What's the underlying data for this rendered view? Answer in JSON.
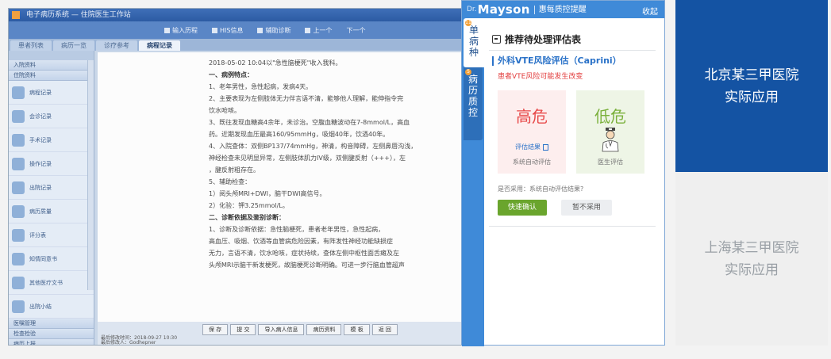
{
  "emr": {
    "title": "电子病历系统 — 住院医生工作站",
    "toolbar": [
      "输入历程",
      "HIS信息",
      "辅助诊断",
      "上一个",
      "下一个"
    ],
    "tabs": [
      "患者列表",
      "病历一览",
      "诊疗参考",
      "病程记录"
    ],
    "left_top_cats": [
      "入院资料",
      "住院资料"
    ],
    "left_items": [
      "病程记录",
      "会诊记录",
      "手术记录",
      "操作记录",
      "出院记录",
      "病历质量",
      "评分表",
      "知情同意书",
      "其他医疗文书",
      "出院小结"
    ],
    "left_bottom_cats": [
      "医嘱管理",
      "检查检验",
      "病历上报",
      "病历管理",
      "报表查询"
    ],
    "doc_lines": [
      {
        "t": "2018-05-02 10:04以\"急性脑梗死\"收入我科。",
        "b": false
      },
      {
        "t": "一、病例特点：",
        "b": true
      },
      {
        "t": "1、老年男性，急性起病，发病4天。",
        "b": false
      },
      {
        "t": "2、主要表现为左侧肢体无力伴言语不清，能够他人理解，能伸指令完",
        "b": false
      },
      {
        "t": "   饮水呛咳。",
        "b": false
      },
      {
        "t": "3、既往发现血糖高4余年，未诊治。空腹血糖波动在7-8mmol/L，高血",
        "b": false
      },
      {
        "t": "药。近期发现血压最高160/95mmHg，吸烟40年，饮酒40年。",
        "b": false
      },
      {
        "t": "4、入院查体：双侧BP137/74mmHg，神清，构音障碍，左侧鼻唇沟浅，",
        "b": false
      },
      {
        "t": "   神经检查未见明显异常，左侧肢体肌力IV级，双侧腱反射（+++），左",
        "b": false
      },
      {
        "t": "   ，腱反射粗存在。",
        "b": false
      },
      {
        "t": "5、辅助检查：",
        "b": false
      },
      {
        "t": "1）阅头颅MRI+DWI，脑干DWI高信号。",
        "b": false
      },
      {
        "t": "2）化验：钾3.25mmol/L。",
        "b": false
      },
      {
        "t": "二、诊断依据及鉴别诊断：",
        "b": true
      },
      {
        "t": "      1、诊断及诊断依据：急性脑梗死，患者老年男性，急性起病，",
        "b": false
      },
      {
        "t": "   高血压、吸烟、饮酒等血管病危险因素，有阵发性神经功能缺损症",
        "b": false
      },
      {
        "t": "   无力，言语不清，饮水呛咳，症状持续，查体左侧中枢性面舌瘫及左",
        "b": false
      },
      {
        "t": "   头颅MRI示脑干新发梗死，故脑梗死诊断明确。可进一步行脑血管超声",
        "b": false
      }
    ],
    "bottom_buttons": [
      "保 存",
      "提 交",
      "导入病人信息",
      "病历资料",
      "模 板",
      "返 回"
    ],
    "footer": [
      "最后修改时间：2018-09-27 10:30",
      "最后修改人：Godhepner"
    ]
  },
  "panel": {
    "brand_prefix": "Dr.",
    "brand": "Mayson",
    "brand_sub": "惠每质控提醒",
    "collapse": "收起",
    "side_tabs": [
      {
        "label": "单病种",
        "badge": "11"
      },
      {
        "label": "病历质控",
        "badge": "5"
      }
    ],
    "title": "推荐待处理评估表",
    "sub_title": "外科VTE风险评估（Caprini）",
    "warning": "患者VTE风险可能发生改变",
    "card_high": {
      "label": "高危",
      "link": "评估结果",
      "caption": "系统自动评估"
    },
    "card_low": {
      "label": "低危",
      "caption": "医生评估"
    },
    "question": "是否采用：系统自动评估结果?",
    "confirm": "快速确认",
    "reject": "暂不采用",
    "colors": {
      "header": "#3f8ad8",
      "high": "#e84a4a",
      "low": "#7ab03b",
      "confirm": "#6aa52d",
      "link": "#2a72c8"
    }
  },
  "hospitals": [
    {
      "name": "北京某三甲医院",
      "sub": "实际应用",
      "active": true
    },
    {
      "name": "上海某三甲医院",
      "sub": "实际应用",
      "active": false
    }
  ]
}
